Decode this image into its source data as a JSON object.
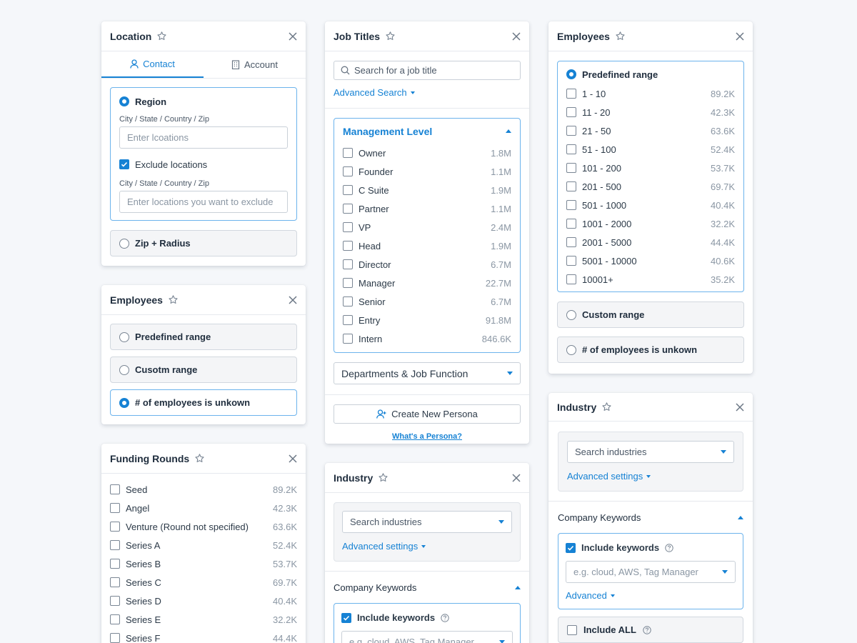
{
  "location": {
    "title": "Location",
    "tabs": [
      "Contact",
      "Account"
    ],
    "region_label": "Region",
    "field_label_1": "City / State / Country / Zip",
    "input_1_placeholder": "Enter lcoations",
    "exclude_label": "Exclude locations",
    "field_label_2": "City / State / Country / Zip",
    "input_2_placeholder": "Enter locations you want to exclude",
    "zip_radius_label": "Zip + Radius"
  },
  "employees_small": {
    "title": "Employees",
    "options": [
      "Predefined range",
      "Cusotm range",
      "# of employees is unkown"
    ],
    "selected_index": 2
  },
  "funding": {
    "title": "Funding Rounds",
    "items": [
      {
        "label": "Seed",
        "count": "89.2K"
      },
      {
        "label": "Angel",
        "count": "42.3K"
      },
      {
        "label": "Venture (Round not specified)",
        "count": "63.6K"
      },
      {
        "label": "Series A",
        "count": "52.4K"
      },
      {
        "label": "Series B",
        "count": "53.7K"
      },
      {
        "label": "Series C",
        "count": "69.7K"
      },
      {
        "label": "Series D",
        "count": "40.4K"
      },
      {
        "label": "Series E",
        "count": "32.2K"
      },
      {
        "label": "Series F",
        "count": "44.4K"
      }
    ]
  },
  "job_titles": {
    "title": "Job Titles",
    "search_placeholder": "Search for a job title",
    "advanced_search": "Advanced Search",
    "management_level": "Management Level",
    "levels": [
      {
        "label": "Owner",
        "count": "1.8M"
      },
      {
        "label": "Founder",
        "count": "1.1M"
      },
      {
        "label": "C Suite",
        "count": "1.9M"
      },
      {
        "label": "Partner",
        "count": "1.1M"
      },
      {
        "label": "VP",
        "count": "2.4M"
      },
      {
        "label": "Head",
        "count": "1.9M"
      },
      {
        "label": "Director",
        "count": "6.7M"
      },
      {
        "label": "Manager",
        "count": "22.7M"
      },
      {
        "label": "Senior",
        "count": "6.7M"
      },
      {
        "label": "Entry",
        "count": "91.8M"
      },
      {
        "label": "Intern",
        "count": "846.6K"
      }
    ],
    "departments": "Departments & Job Function",
    "create_persona": "Create New Persona",
    "whats_persona": "What's a Persona?"
  },
  "industry_mid": {
    "title": "Industry",
    "search_placeholder": "Search industries",
    "advanced_settings": "Advanced settings",
    "company_keywords": "Company Keywords",
    "include_keywords": "Include keywords",
    "keywords_placeholder": "e.g. cloud, AWS, Tag Manager"
  },
  "employees_right": {
    "title": "Employees",
    "predefined": "Predefined range",
    "ranges": [
      {
        "label": "1 - 10",
        "count": "89.2K"
      },
      {
        "label": "11 - 20",
        "count": "42.3K"
      },
      {
        "label": "21 - 50",
        "count": "63.6K"
      },
      {
        "label": "51 - 100",
        "count": "52.4K"
      },
      {
        "label": "101 - 200",
        "count": "53.7K"
      },
      {
        "label": "201 - 500",
        "count": "69.7K"
      },
      {
        "label": "501 - 1000",
        "count": "40.4K"
      },
      {
        "label": "1001 - 2000",
        "count": "32.2K"
      },
      {
        "label": "2001 - 5000",
        "count": "44.4K"
      },
      {
        "label": "5001 - 10000",
        "count": "40.6K"
      },
      {
        "label": "10001+",
        "count": "35.2K"
      }
    ],
    "custom_range": "Custom range",
    "unknown": "# of employees is unkown"
  },
  "industry_right": {
    "title": "Industry",
    "search_placeholder": "Search industries",
    "advanced_settings": "Advanced settings",
    "company_keywords": "Company Keywords",
    "include_keywords": "Include keywords",
    "keywords_placeholder": "e.g. cloud, AWS, Tag Manager",
    "advanced": "Advanced",
    "include_all": "Include ALL"
  },
  "colors": {
    "accent": "#1682d4",
    "border_selected": "#6cb3ec"
  },
  "icons": [
    "star-icon",
    "close-icon",
    "user-icon",
    "building-icon",
    "search-icon",
    "check-icon",
    "help-icon",
    "add-user-icon",
    "chevron-down-icon",
    "chevron-up-icon"
  ]
}
